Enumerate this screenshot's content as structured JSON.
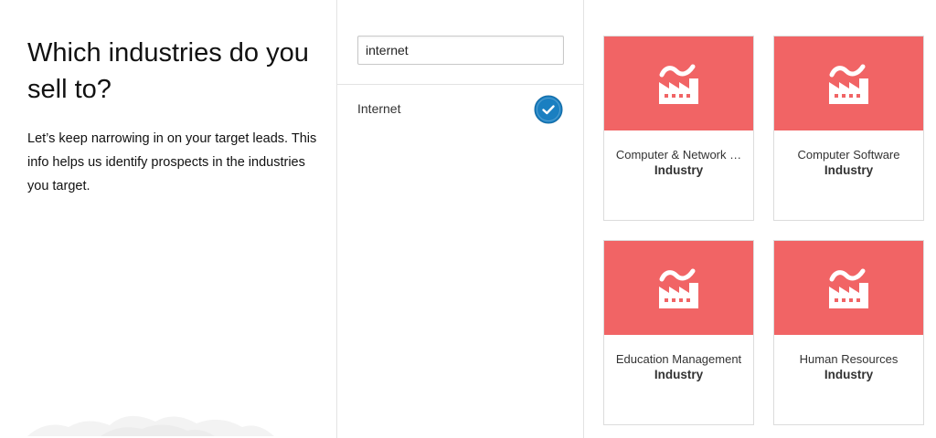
{
  "intro": {
    "title": "Which industries do you sell to?",
    "description": "Let’s keep narrowing in on your target leads. This info helps us identify prospects in the industries you target."
  },
  "search": {
    "value": "internet",
    "placeholder": ""
  },
  "results": [
    {
      "label": "Internet",
      "selected": true
    }
  ],
  "cards": [
    {
      "name": "Computer & Network …",
      "type": "Industry",
      "icon": "factory-icon"
    },
    {
      "name": "Computer Software",
      "type": "Industry",
      "icon": "factory-icon"
    },
    {
      "name": "Education Management",
      "type": "Industry",
      "icon": "factory-icon"
    },
    {
      "name": "Human Resources",
      "type": "Industry",
      "icon": "factory-icon"
    }
  ],
  "colors": {
    "card_banner": "#f16465",
    "check_badge": "#1a7fc1",
    "divider": "#e3e3e3"
  }
}
